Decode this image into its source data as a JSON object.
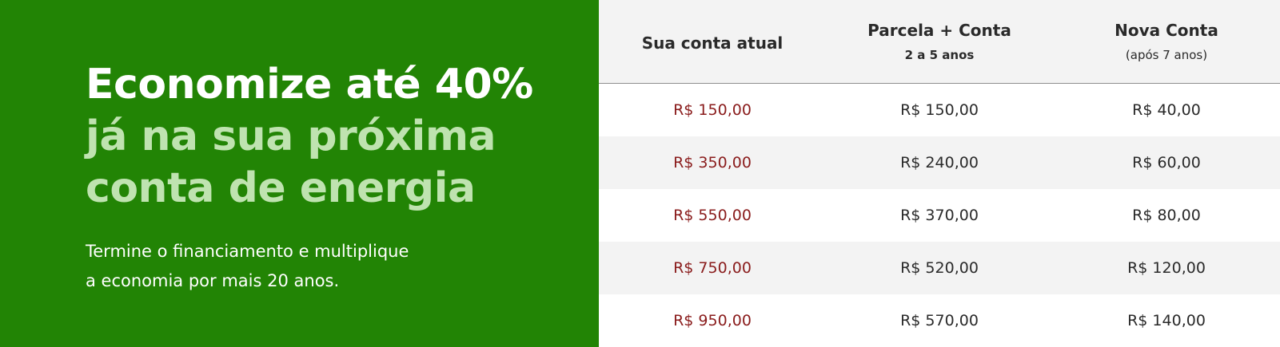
{
  "promo": {
    "headline_line1": "Economize até 40%",
    "headline_line2": "já na sua próxima",
    "headline_line3": "conta de energia",
    "subtext_line1": "Termine o financiamento e multiplique",
    "subtext_line2": "a economia por mais 20 anos."
  },
  "table": {
    "headers": [
      {
        "label": "Sua conta atual",
        "sublabel": ""
      },
      {
        "label": "Parcela + Conta",
        "sublabel": "2 a 5 anos"
      },
      {
        "label": "Nova Conta",
        "sublabel": "(após 7 anos)"
      }
    ],
    "rows": [
      [
        "R$ 150,00",
        "R$ 150,00",
        "R$ 40,00"
      ],
      [
        "R$ 350,00",
        "R$ 240,00",
        "R$ 60,00"
      ],
      [
        "R$ 550,00",
        "R$ 370,00",
        "R$ 80,00"
      ],
      [
        "R$ 750,00",
        "R$ 520,00",
        "R$ 120,00"
      ],
      [
        "R$ 950,00",
        "R$ 570,00",
        "R$ 140,00"
      ]
    ]
  },
  "colors": {
    "promo_background": "#228405",
    "headline_accent": "#bfe3b0",
    "current_bill_text": "#8a1c1c",
    "alt_row_background": "#f3f3f3"
  }
}
